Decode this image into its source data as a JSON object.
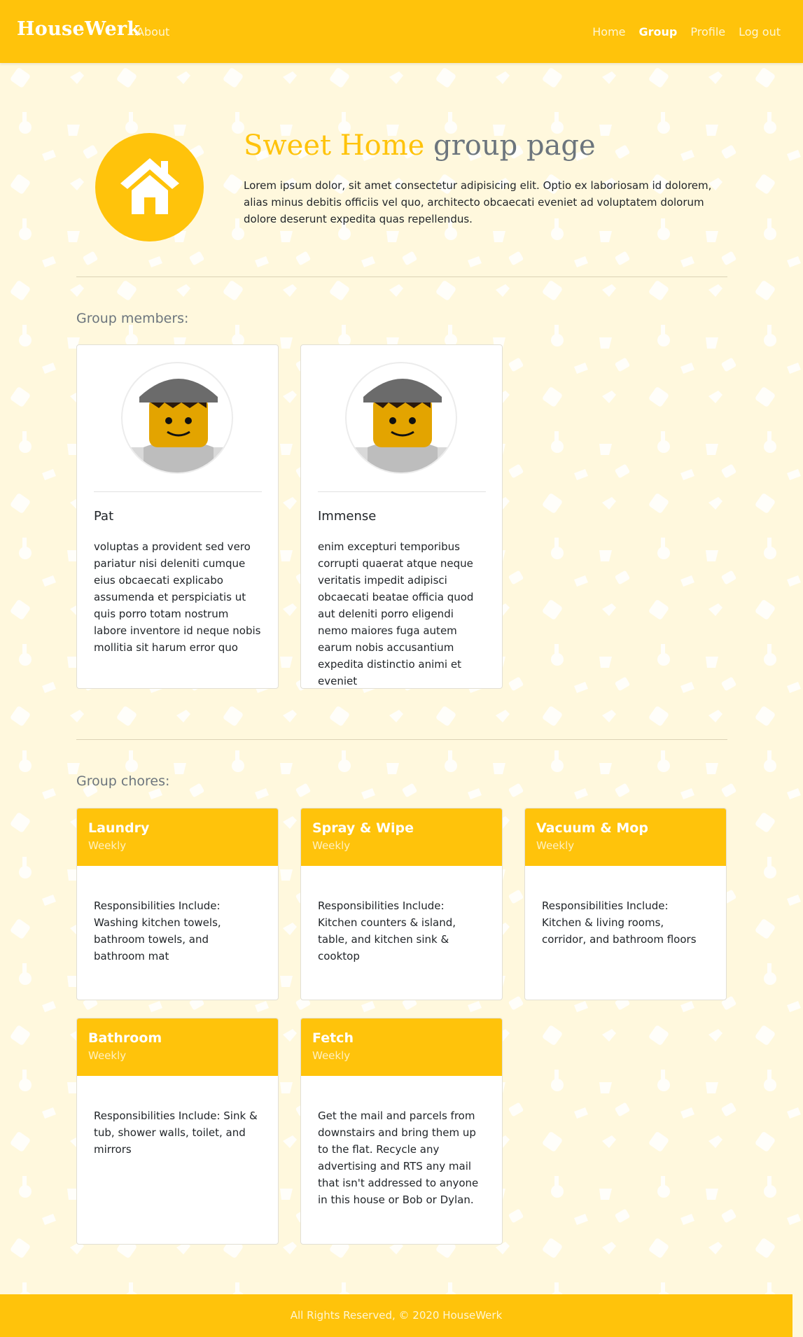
{
  "navbar": {
    "brand": "HouseWerk",
    "about": "About",
    "links": [
      "Home",
      "Group",
      "Profile",
      "Log out"
    ],
    "active": "Group"
  },
  "header": {
    "title_accent": "Sweet Home",
    "title_rest": " group page",
    "description": "Lorem ipsum dolor, sit amet consectetur adipisicing elit. Optio ex laboriosam id dolorem, alias minus debitis officiis vel quo, architecto obcaecati eveniet ad voluptatem dolorum dolore deserunt expedita quas repellendus.",
    "icon": "house-icon"
  },
  "members": {
    "label": "Group members:",
    "items": [
      {
        "name": "Pat",
        "bio": "voluptas a provident sed vero pariatur nisi deleniti cumque eius obcaecati explicabo assumenda et perspiciatis ut quis porro totam nostrum labore inventore id neque nobis mollitia sit harum error quo"
      },
      {
        "name": "Immense",
        "bio": "enim excepturi temporibus corrupti quaerat atque neque veritatis impedit adipisci obcaecati beatae officia quod aut deleniti porro eligendi nemo maiores fuga autem earum nobis accusantium expedita distinctio animi et eveniet"
      }
    ]
  },
  "chores": {
    "label": "Group chores:",
    "items": [
      {
        "title": "Laundry",
        "frequency": "Weekly",
        "description": "Responsibilities Include: Washing kitchen towels, bathroom towels, and bathroom mat"
      },
      {
        "title": "Spray & Wipe",
        "frequency": "Weekly",
        "description": "Responsibilities Include: Kitchen counters & island, table, and kitchen sink & cooktop"
      },
      {
        "title": "Vacuum & Mop",
        "frequency": "Weekly",
        "description": "Responsibilities Include: Kitchen & living rooms, corridor, and bathroom floors"
      },
      {
        "title": "Bathroom",
        "frequency": "Weekly",
        "description": "Responsibilities Include: Sink & tub, shower walls, toilet, and mirrors"
      },
      {
        "title": "Fetch",
        "frequency": "Weekly",
        "description": "Get the mail and parcels from downstairs and bring them up to the flat. Recycle any advertising and RTS any mail that isn't addressed to anyone in this house or Bob or Dylan."
      }
    ]
  },
  "footer": {
    "text": "All Rights Reserved, © 2020 HouseWerk"
  },
  "colors": {
    "accent": "#ffc30b",
    "background": "#fff8dd",
    "muted": "#6c757d"
  }
}
